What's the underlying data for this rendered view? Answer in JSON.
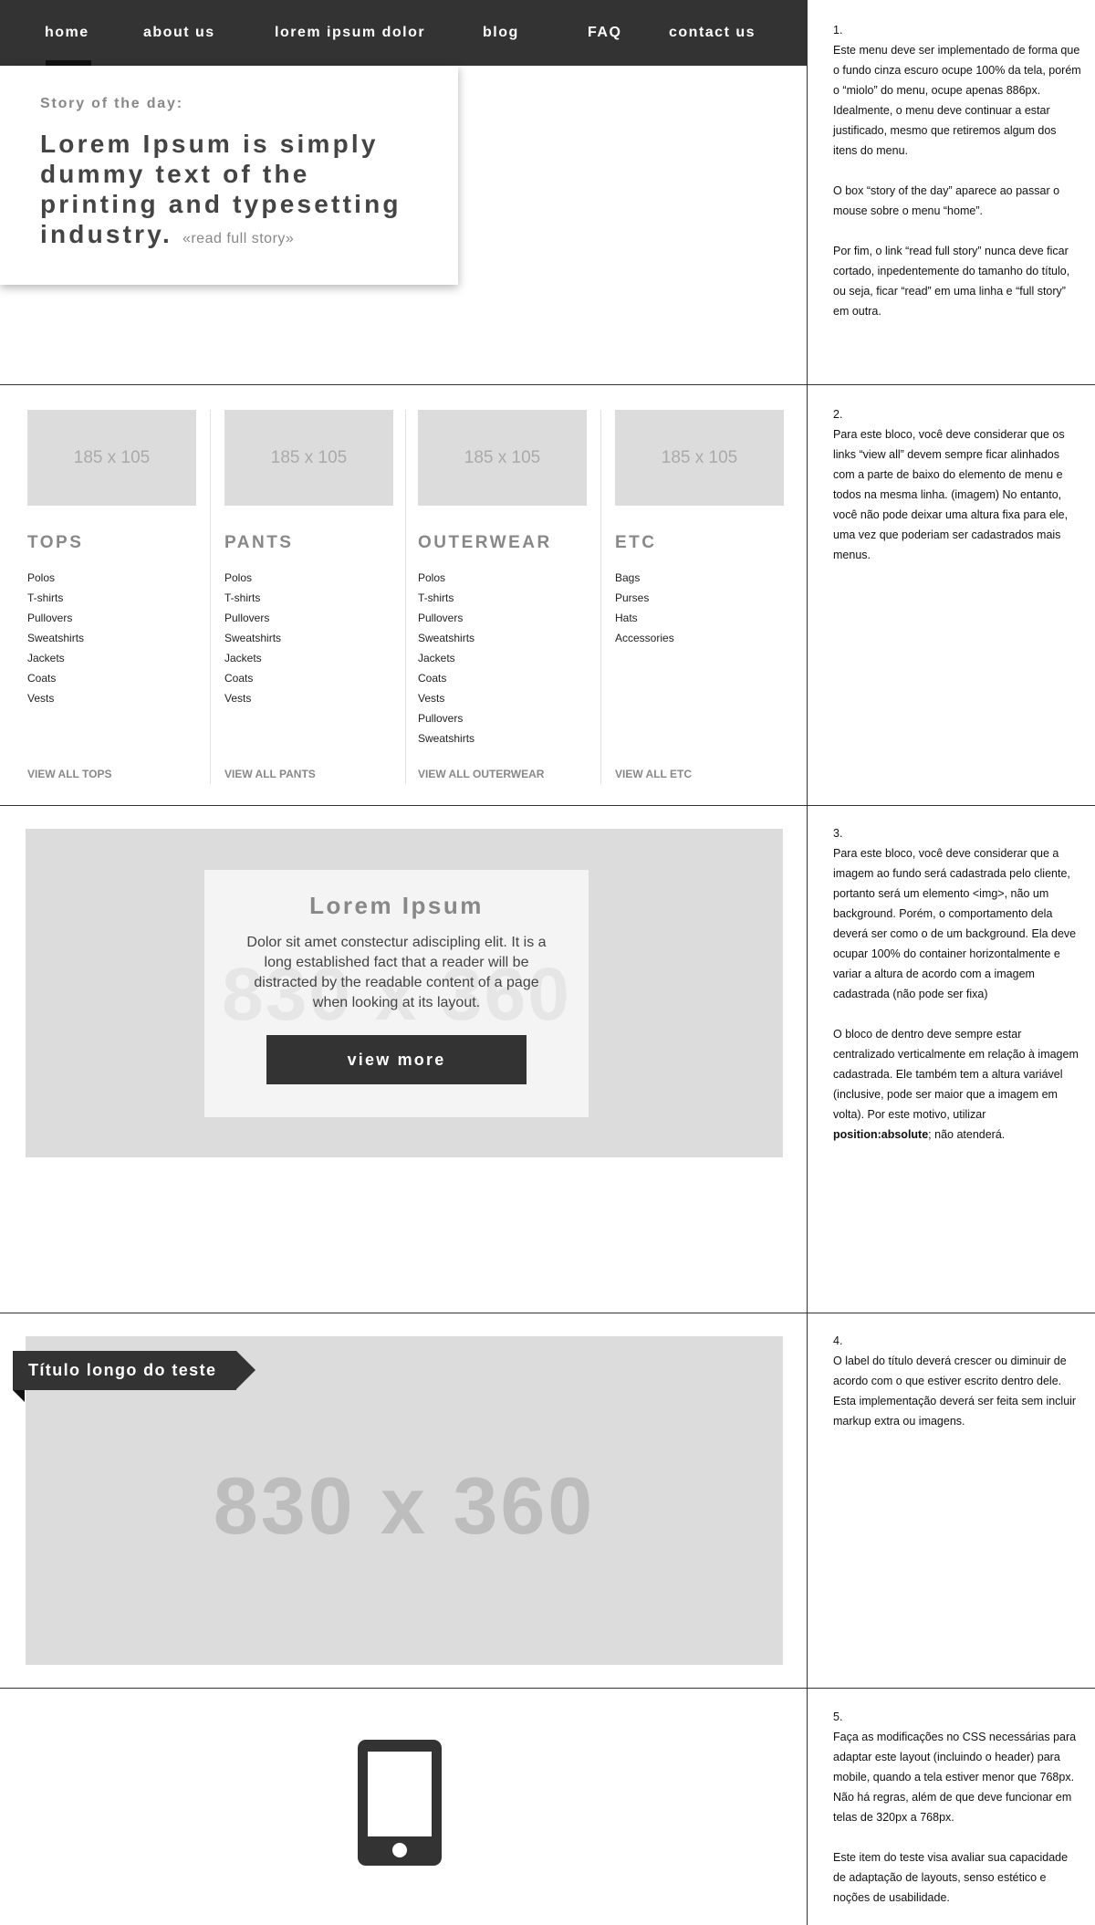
{
  "nav": {
    "items": [
      {
        "label": "home"
      },
      {
        "label": "about us"
      },
      {
        "label": "lorem ipsum dolor"
      },
      {
        "label": "blog"
      },
      {
        "label": "FAQ"
      },
      {
        "label": "contact us"
      }
    ]
  },
  "story": {
    "label": "Story of the day:",
    "title": "Lorem Ipsum is simply dummy text of the printing and typesetting industry.",
    "link": "«read full story»"
  },
  "categories": [
    {
      "thumb": "185 x 105",
      "title": "TOPS",
      "items": [
        "Polos",
        "T-shirts",
        "Pullovers",
        "Sweatshirts",
        "Jackets",
        "Coats",
        "Vests"
      ],
      "view_all": "VIEW ALL TOPS"
    },
    {
      "thumb": "185 x 105",
      "title": "PANTS",
      "items": [
        "Polos",
        "T-shirts",
        "Pullovers",
        "Sweatshirts",
        "Jackets",
        "Coats",
        "Vests"
      ],
      "view_all": "VIEW ALL PANTS"
    },
    {
      "thumb": "185 x 105",
      "title": "OUTERWEAR",
      "items": [
        "Polos",
        "T-shirts",
        "Pullovers",
        "Sweatshirts",
        "Jackets",
        "Coats",
        "Vests",
        "Pullovers",
        "Sweatshirts"
      ],
      "view_all": "VIEW ALL OUTERWEAR"
    },
    {
      "thumb": "185 x 105",
      "title": "ETC",
      "items": [
        "Bags",
        "Purses",
        "Hats",
        "Accessories"
      ],
      "view_all": "VIEW ALL ETC"
    }
  ],
  "promo": {
    "ghost": "830 x 360",
    "title": "Lorem Ipsum",
    "text": "Dolor sit amet constectur adiscipling elit. It is a long established fact that a reader will be distracted by the readable content of a page when looking at its layout.",
    "button": "view more"
  },
  "banner2": {
    "ribbon": "Título longo do teste",
    "placeholder": "830 x 360"
  },
  "phone_icon": "mobile-phone-icon",
  "notes": [
    {
      "number": "1.",
      "paragraphs": [
        "Este menu deve ser implementado de forma que o fundo cinza escuro ocupe 100% da tela, porém o “miolo” do menu, ocupe apenas 886px.  Idealmente, o  menu deve continuar a estar justificado, mesmo que retiremos algum dos itens do menu.",
        "O box “story of the day” aparece ao passar o mouse sobre o menu “home”.",
        "Por fim, o link “read full story” nunca deve ficar cortado, inpedentemente do tamanho do título, ou seja, ficar “read” em uma linha e “full story” em outra."
      ]
    },
    {
      "number": "2.",
      "paragraphs": [
        "Para este bloco, você deve considerar que os links “view all” devem sempre ficar alinhados com a parte de baixo do elemento de menu e todos na mesma linha. (imagem) No entanto, você não pode deixar uma altura fixa para ele, uma vez que poderiam ser cadastrados mais menus."
      ]
    },
    {
      "number": "3.",
      "paragraphs": [
        "Para este bloco, você deve considerar que a imagem ao fundo será cadastrada pelo cliente, portanto será um elemento <img>, não um background. Porém, o comportamento dela deverá ser como o de um background. Ela deve ocupar 100% do container horizontalmente e variar a altura de acordo com a imagem cadastrada (não pode ser fixa)"
      ],
      "p2_before": "O bloco de dentro deve sempre estar centralizado verticalmente em relação à imagem cadastrada. Ele também tem a altura variável (inclusive, pode ser maior que a imagem em volta). Por este motivo, utilizar ",
      "p2_bold": "position:absolute",
      "p2_after": "; não atenderá."
    },
    {
      "number": "4.",
      "paragraphs": [
        "O label do título deverá crescer ou diminuir de acordo com o que estiver escrito dentro dele. Esta implementação deverá ser feita sem incluir markup extra ou imagens."
      ]
    },
    {
      "number": "5.",
      "paragraphs": [
        "Faça as modificações no CSS necessárias para adaptar este layout (incluindo o header) para mobile, quando a tela estiver menor que 768px. Não há regras, além de que deve funcionar em telas de 320px a 768px.",
        "Este item do teste visa avaliar sua capacidade de adaptação de layouts, senso estético e noções de usabilidade."
      ]
    }
  ]
}
